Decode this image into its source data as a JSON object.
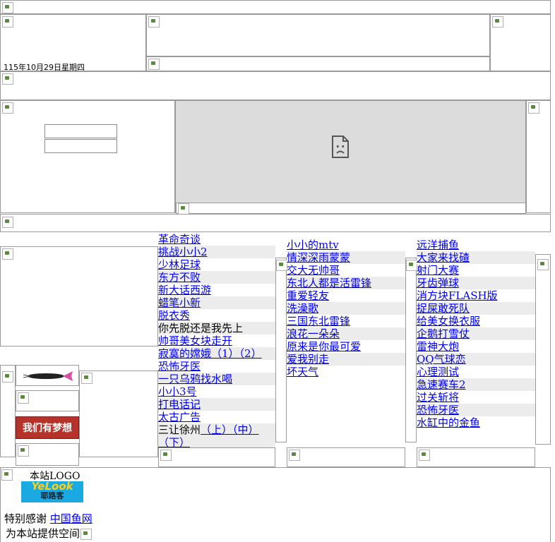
{
  "header": {
    "date_text": "115年10月29日星期四"
  },
  "media_placeholder_icon": "sad-document-icon",
  "column1": {
    "items": [
      {
        "label": "革命奇谈",
        "link": true
      },
      {
        "label": "挑战小小2",
        "link": true
      },
      {
        "label": "少林足球",
        "link": true
      },
      {
        "label": "东方不败",
        "link": true
      },
      {
        "label": "新大话西游",
        "link": true
      },
      {
        "label": "蜡笔小新",
        "link": true
      },
      {
        "label": "脱衣秀",
        "link": true
      },
      {
        "label": "你先脱还是我先上",
        "link": false
      },
      {
        "label": "帅哥美女块走开",
        "link": true
      },
      {
        "label": "寂寞的嫦娥（1）（2）",
        "link": true
      },
      {
        "label": "恐怖牙医",
        "link": true
      },
      {
        "label": "一只乌鸦找水喝",
        "link": true
      },
      {
        "label": "小小3号",
        "link": true
      },
      {
        "label": "打电话记",
        "link": true
      },
      {
        "label": "太古广告",
        "link": true
      }
    ],
    "last_item": {
      "prefix": "三让徐州",
      "parts": [
        "（上）",
        "（中）",
        "（下）"
      ]
    }
  },
  "column2": {
    "items": [
      "小小的mtv",
      "情深深雨蒙蒙",
      "交大无帅哥",
      "东北人都是活雷锋",
      "重爱轻友",
      "洗澡歌",
      "三国东北雷锋",
      "浪花一朵朵",
      "原来是你最可爱",
      "爱我别走",
      "坏天气"
    ]
  },
  "column3": {
    "items": [
      "远洋捕鱼",
      "大家来找碴",
      "射门大赛",
      "牙齿弹球",
      "消方块FLASH版",
      "捉屎敢死队",
      "给美女换衣服",
      "企鹅打雪仗",
      "雷神大炮",
      "QQ气球恋",
      "心理测试",
      "急速赛车2",
      "过关斩将",
      "恐怖牙医",
      "水缸中的金鱼"
    ]
  },
  "banner": {
    "dream_text": "我们有梦想"
  },
  "footer": {
    "logo_label": "本站LOGO",
    "logo_text": "YeLook",
    "logo_subtext": "耶路客",
    "thanks_label": "特别感谢",
    "thanks_link": "中国鱼网",
    "space_text": "为本站提供空间"
  },
  "colors": {
    "link": "#0000ee",
    "row_stripe": "#ececec",
    "dream_bg": "#c0392b",
    "dream_text": "#ffffff",
    "logo_bg": "#1aa9e0",
    "logo_text": "#f4d21f"
  }
}
